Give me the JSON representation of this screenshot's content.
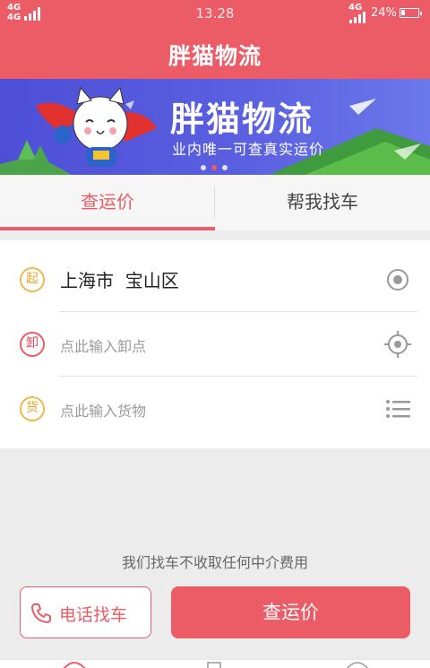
{
  "status_bar": {
    "network_left_top": "4G",
    "network_left_bottom": "4G",
    "time": "13.28",
    "network_right": "4G",
    "battery_percent": "24%",
    "battery_level": 0.24
  },
  "header": {
    "title": "胖猫物流"
  },
  "banner": {
    "title": "胖猫物流",
    "subtitle": "业内唯一可查真实运价",
    "active_dot_index": 1,
    "dot_count": 3
  },
  "tabs": [
    {
      "label": "查运价",
      "active": true
    },
    {
      "label": "帮我找车",
      "active": false
    }
  ],
  "form": {
    "start": {
      "badge": "起",
      "value": "上海市  宝山区",
      "icon": "target-icon"
    },
    "unload": {
      "badge": "卸",
      "placeholder": "点此输入卸点",
      "icon": "crosshair-icon"
    },
    "cargo": {
      "badge": "货",
      "placeholder": "点此输入货物",
      "icon": "list-icon"
    }
  },
  "notice": "我们找车不收取任何中介费用",
  "actions": {
    "phone_button": "电话找车",
    "quote_button": "查运价"
  },
  "colors": {
    "brand_red": "#ec5c67",
    "banner_blue": "#5a5fe0",
    "badge_yellow": "#f0b94a"
  }
}
